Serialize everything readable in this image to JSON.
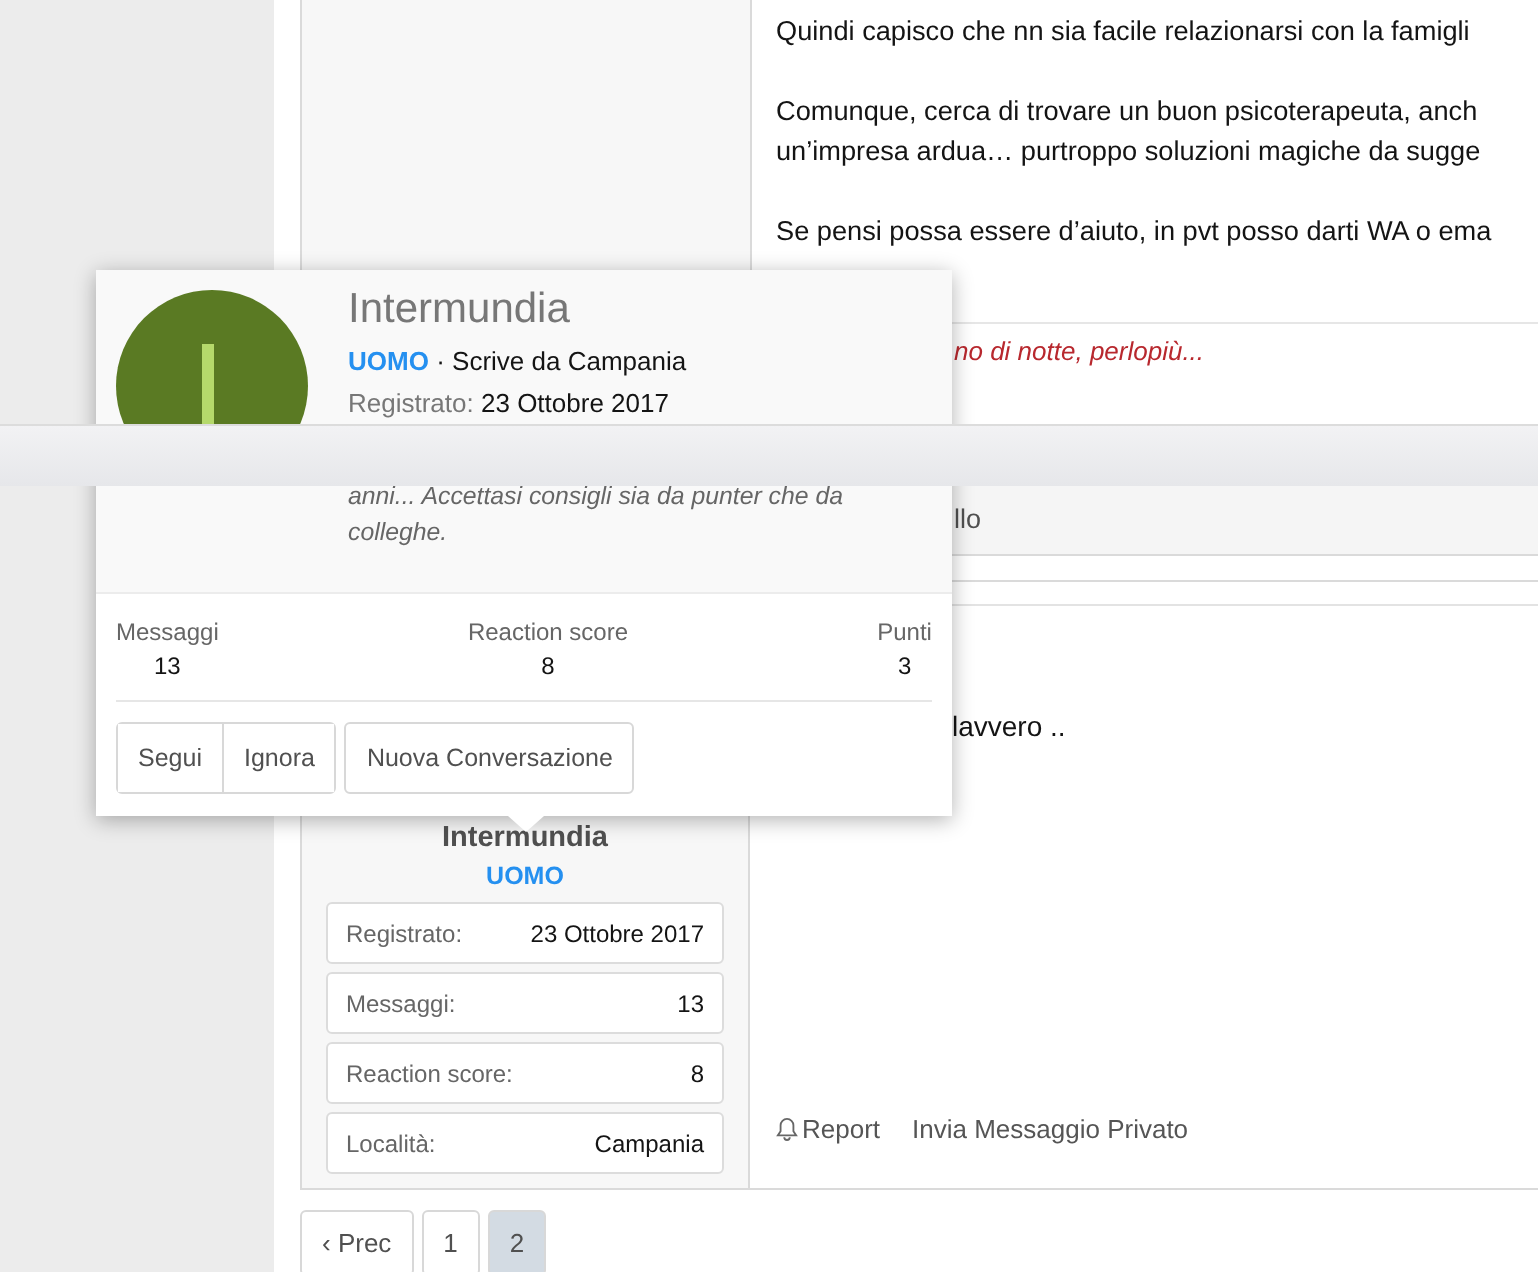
{
  "post_1": {
    "paragraphs": [
      "Quindi capisco che nn sia facile relazionarsi con la famigli",
      "Comunque, cerca di trovare un buon psicoterapeuta, anch\nun’impresa ardua… purtroppo soluzioni magiche da sugge",
      "Se pensi possa essere d’aiuto, in pvt posso darti WA o ema"
    ],
    "signature": "no di notte, perlopiù...",
    "footer_text": "llo"
  },
  "post_2": {
    "message": "lavvero ..",
    "user": {
      "name": "Intermundia",
      "title": "UOMO",
      "info": [
        {
          "label": "Registrato:",
          "value": "23 Ottobre 2017"
        },
        {
          "label": "Messaggi:",
          "value": "13"
        },
        {
          "label": "Reaction score:",
          "value": "8"
        },
        {
          "label": "Località:",
          "value": "Campania"
        }
      ]
    },
    "actions": [
      {
        "kind": "report",
        "label": "Report"
      },
      {
        "kind": "link",
        "label": "Invia Messaggio Privato"
      }
    ]
  },
  "popup": {
    "name": "Intermundia",
    "title": "UOMO",
    "location": "· Scrive da Campania",
    "registered_label": "Registrato:",
    "registered_value": "23 Ottobre 2017",
    "about": "anni... Accettasi consigli sia da punter che da colleghe.",
    "stats": [
      {
        "label": "Messaggi",
        "value": "13"
      },
      {
        "label": "Reaction score",
        "value": "8"
      },
      {
        "label": "Punti",
        "value": "3"
      }
    ],
    "buttons": [
      {
        "label": "Segui",
        "group": true
      },
      {
        "label": "Ignora",
        "group": true
      },
      {
        "label": "Nuova Conversazione",
        "group": false
      }
    ]
  },
  "pagination": [
    {
      "label": "‹ Prec",
      "selected": false
    },
    {
      "label": "1",
      "selected": false
    },
    {
      "label": "2",
      "selected": true
    }
  ]
}
